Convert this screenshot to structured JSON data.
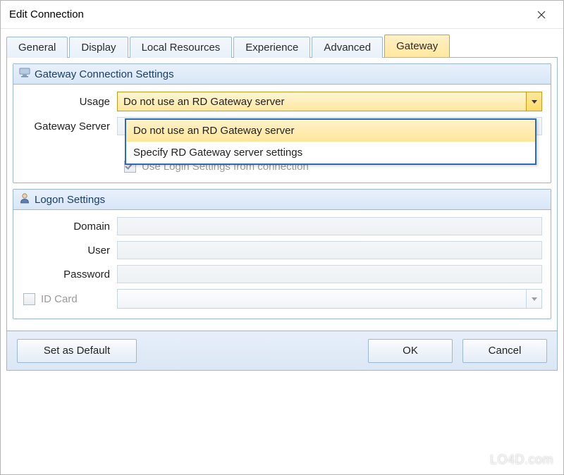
{
  "window": {
    "title": "Edit Connection"
  },
  "tabs": [
    {
      "label": "General"
    },
    {
      "label": "Display"
    },
    {
      "label": "Local Resources"
    },
    {
      "label": "Experience"
    },
    {
      "label": "Advanced"
    },
    {
      "label": "Gateway"
    }
  ],
  "gateway_group": {
    "title": "Gateway Connection Settings",
    "usage_label": "Usage",
    "usage_value": "Do not use an RD Gateway server",
    "server_label": "Gateway Server",
    "server_value": "",
    "use_login_label": "Use Login Settings from connection",
    "options": [
      "Do not use an RD Gateway server",
      "Specify RD Gateway server settings"
    ]
  },
  "logon_group": {
    "title": "Logon Settings",
    "domain_label": "Domain",
    "domain_value": "",
    "user_label": "User",
    "user_value": "",
    "password_label": "Password",
    "password_value": "",
    "idcard_label": "ID Card",
    "idcard_value": ""
  },
  "buttons": {
    "set_default": "Set as Default",
    "ok": "OK",
    "cancel": "Cancel"
  },
  "watermark": "LO4D.com"
}
